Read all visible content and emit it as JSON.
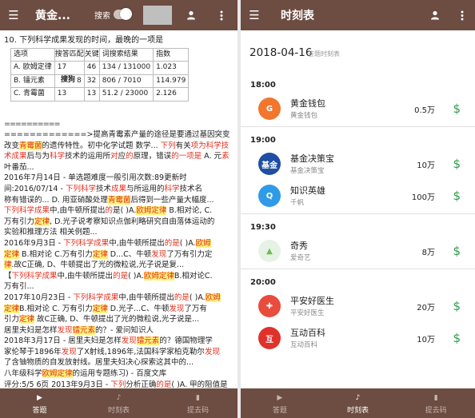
{
  "left": {
    "title": "黄金...",
    "toggle_label": "搜索",
    "question": {
      "title": "10. 下列科学成果发现的时间，最晚的一项是",
      "headers": [
        "选项",
        "搜答",
        "匹配",
        "关键",
        "词搜索结果",
        "指数"
      ],
      "rows": [
        [
          "A. 欧姆定律",
          "17",
          "46",
          "134 / 131000",
          "1.023"
        ],
        [
          "B. 镭元素",
          "8",
          "32",
          "806 / 7010",
          "114.979"
        ],
        [
          "C. 青霉菌",
          "13",
          "13",
          "51.2 / 23000",
          "2.126"
        ]
      ],
      "search_word": "搜狗"
    },
    "divider": "==========",
    "snippet": [
      [
        [
          "p",
          "=============>提高青霉素产量的途径是要通过基因突变改变"
        ],
        [
          "h",
          "青霉菌"
        ],
        [
          "p",
          "的遗传特性。初中化学试题 数学... "
        ],
        [
          "r",
          "下列"
        ],
        [
          "p",
          "有关"
        ],
        [
          "r",
          "项为科学技"
        ]
      ],
      [
        [
          "r",
          "术成果"
        ],
        [
          "p",
          "后与为"
        ],
        [
          "r",
          "科学"
        ],
        [
          "p",
          "技术的运用所"
        ],
        [
          "r",
          "对"
        ],
        [
          "p",
          "应"
        ],
        [
          "r",
          "的"
        ],
        [
          "p",
          "原理，错误"
        ],
        [
          "r",
          "的"
        ],
        [
          "r",
          "一项是"
        ],
        [
          "p",
          " A. 元"
        ],
        [
          "r",
          "素"
        ],
        [
          "p",
          "叶番茄..."
        ]
      ],
      [
        [
          "p",
          "2016年7月14日 - 单选题难度一般引用次数:89更新时"
        ]
      ],
      [
        [
          "p",
          "间:2016/07/14 - "
        ],
        [
          "r",
          "下列科学"
        ],
        [
          "p",
          "技术"
        ],
        [
          "r",
          "成果"
        ],
        [
          "p",
          "与所运用的"
        ],
        [
          "r",
          "科学"
        ],
        [
          "p",
          "技术名"
        ]
      ],
      [
        [
          "p",
          "称有错误的... D. 用亚硝酸处理"
        ],
        [
          "h",
          "青霉菌"
        ],
        [
          "p",
          "后得到一些产量大幅度..."
        ]
      ],
      [
        [
          "r",
          "下列科学成果"
        ],
        [
          "p",
          "中,由牛顿所提出"
        ],
        [
          "r",
          "的"
        ],
        [
          "p",
          "是( )A."
        ],
        [
          "h",
          "欧姆定律"
        ],
        [
          "p",
          " B.相对论, C."
        ]
      ],
      [
        [
          "p",
          "万有引力"
        ],
        [
          "h",
          "定律"
        ],
        [
          "p",
          ", D.光子说考察知识点伽利略研究自由落体运动的"
        ]
      ],
      [
        [
          "p",
          "实验和推理方法 相关例题..."
        ]
      ],
      [
        [
          "p",
          "2016年9月3日 - "
        ],
        [
          "r",
          "下列科学成果"
        ],
        [
          "p",
          "中,由牛顿所提出"
        ],
        [
          "r",
          "的是"
        ],
        [
          "p",
          "( )A."
        ],
        [
          "h",
          "欧姆"
        ]
      ],
      [
        [
          "h",
          "定律"
        ],
        [
          "p",
          " B.相对论 C.万有引力"
        ],
        [
          "h",
          "定律"
        ],
        [
          "p",
          " D...C、牛顿"
        ],
        [
          "r",
          "发现"
        ],
        [
          "p",
          "了万有引力定"
        ]
      ],
      [
        [
          "h",
          "律"
        ],
        [
          "p",
          ".故C正确, D、牛顿提出了光的微粒说,光子说是复..."
        ]
      ],
      [
        [
          "p",
          "【"
        ],
        [
          "r",
          "下列科学成果"
        ],
        [
          "p",
          "中,由牛顿所提出"
        ],
        [
          "r",
          "的是"
        ],
        [
          "p",
          "( )A."
        ],
        [
          "h",
          "欧姆定律"
        ],
        [
          "p",
          "B.相对论C."
        ]
      ],
      [
        [
          "p",
          "万有引..."
        ]
      ],
      [
        [
          "p",
          "2017年10月23日 - "
        ],
        [
          "r",
          "下列科学成果"
        ],
        [
          "p",
          "中,由牛顿所提出"
        ],
        [
          "r",
          "的是"
        ],
        [
          "p",
          "( )A."
        ],
        [
          "h",
          "欧姆"
        ]
      ],
      [
        [
          "h",
          "定律"
        ],
        [
          "p",
          "B.相对论 C. 万有引力"
        ],
        [
          "h",
          "定律"
        ],
        [
          "p",
          " D.光子...C、牛顿"
        ],
        [
          "r",
          "发现"
        ],
        [
          "p",
          "了万有"
        ]
      ],
      [
        [
          "p",
          "引力"
        ],
        [
          "h",
          "定律"
        ],
        [
          "p",
          " 故C正确, D、牛顿提出了光的微粒说,光子说是..."
        ]
      ],
      [
        [
          "p",
          "居里夫妇是怎样"
        ],
        [
          "r",
          "发现"
        ],
        [
          "h",
          "镭元素"
        ],
        [
          "p",
          "的？- 爱问知识人"
        ]
      ],
      [
        [
          "p",
          "2018年3月17日 - 居里夫妇是怎样"
        ],
        [
          "r",
          "发现"
        ],
        [
          "h",
          "镭元素"
        ],
        [
          "p",
          "的？德国物理学"
        ]
      ],
      [
        [
          "p",
          "家伦琴于1896年"
        ],
        [
          "r",
          "发现"
        ],
        [
          "p",
          "了X射线,1896年,法国科学家柏克勒尔"
        ],
        [
          "r",
          "发现"
        ]
      ],
      [
        [
          "p",
          "了含铀物质的自发放射线。居里夫妇决心探索这其中的..."
        ]
      ],
      [
        [
          "p",
          "八年级科学"
        ],
        [
          "h",
          "欧姆定律"
        ],
        [
          "p",
          "的运用专题练习) - 百度文库"
        ]
      ],
      [
        [
          "p",
          " 评分:5/5 6页 2013年9月3日 - "
        ],
        [
          "r",
          "下列"
        ],
        [
          "p",
          "分析正确"
        ],
        [
          "r",
          "的是"
        ],
        [
          "p",
          "( )A. 甲的阻值是"
        ]
      ],
      [
        [
          "p",
          "乙八年级"
        ],
        [
          "r",
          "科学"
        ],
        [
          "h",
          "欧姆定律"
        ],
        [
          "p",
          "的运用专题练习一、图像题 1、(2011"
        ]
      ],
      [
        [
          "p",
          "河南)图 1 是甲、乙两电阻的电流与电压关系的图象,现将甲、"
        ]
      ]
    ],
    "nav": [
      {
        "label": "答题",
        "icon": "▶"
      },
      {
        "label": "时刻表",
        "icon": "♪"
      },
      {
        "label": "提去码",
        "icon": "▮"
      }
    ]
  },
  "right": {
    "title": "时刻表",
    "date": "2018-04-16",
    "date_sub": "答题时刻表",
    "groups": [
      {
        "time": "18:00",
        "items": [
          {
            "name": "黄金钱包",
            "sub": "黄金钱包",
            "amount": "0.5万",
            "icon_text": "G",
            "color": "#f2762e"
          }
        ]
      },
      {
        "time": "19:00",
        "items": [
          {
            "name": "基金决策宝",
            "sub": "基金决策宝",
            "amount": "10万",
            "icon_text": "基金",
            "color": "#1f4fa3"
          },
          {
            "name": "知识英雄",
            "sub": "千帆",
            "amount": "100万",
            "icon_text": "Q",
            "color": "#2f9be8"
          }
        ]
      },
      {
        "time": "19:30",
        "items": [
          {
            "name": "奇秀",
            "sub": "爱奇艺",
            "amount": "8万",
            "icon_text": "▲",
            "color": "#e6f2e6"
          }
        ]
      },
      {
        "time": "20:00",
        "items": [
          {
            "name": "平安好医生",
            "sub": "平安好医生",
            "amount": "20万",
            "icon_text": "✚",
            "color": "#e94b3c"
          },
          {
            "name": "互动百科",
            "sub": "互动百科",
            "amount": "10万",
            "icon_text": "互",
            "color": "#e0312a"
          }
        ]
      }
    ],
    "nav": [
      {
        "label": "答题",
        "icon": "▶"
      },
      {
        "label": "时刻表",
        "icon": "♪"
      },
      {
        "label": "提去码",
        "icon": "▮"
      }
    ]
  }
}
